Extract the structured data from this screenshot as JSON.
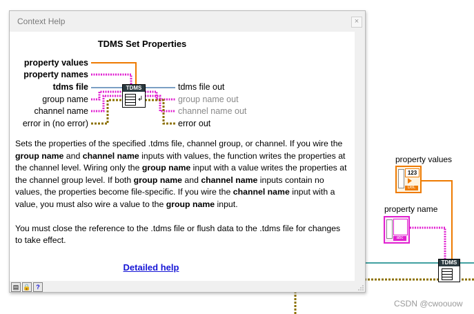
{
  "background": {
    "const_property_values_label": "property values",
    "const_property_name_label": "property name",
    "dbl_badge": "DBL",
    "abc_badge": "abc",
    "num_badge": "123",
    "node_label": "TDMS"
  },
  "window": {
    "title": "Context Help",
    "close": "×"
  },
  "help": {
    "heading": "TDMS Set Properties",
    "node_label": "TDMS",
    "inputs": {
      "property_values": "property values",
      "property_names": "property names",
      "tdms_file": "tdms file",
      "group_name": "group name",
      "channel_name": "channel name",
      "error_in": "error in (no error)"
    },
    "outputs": {
      "tdms_file_out": "tdms file out",
      "group_name_out": "group name out",
      "channel_name_out": "channel name out",
      "error_out": "error out"
    },
    "p1": {
      "s1": "Sets the properties of the specified .tdms file, channel group, or channel.  If you wire the ",
      "b1": "group name",
      "s2": " and ",
      "b2": "channel name",
      "s3": " inputs with values, the function writes the properties at the channel level. Wiring only the ",
      "b3": "group name",
      "s4": " input with a value writes the properties at the channel group level.  If both ",
      "b4": "group name",
      "s5": " and ",
      "b5": "channel name",
      "s6": " inputs contain no values, the properties become file-specific. If you wire the ",
      "b6": "channel name",
      "s7": " input with a value, you must also wire a value to the ",
      "b7": "group name",
      "s8": " input."
    },
    "p2": "You must close the reference to the .tdms file or flush data to the .tdms file for changes to take effect.",
    "detailed_help": "Detailed help"
  },
  "toolbar": {
    "show_optional_terminals": "show-optional-terminals-icon",
    "lock": "lock-icon",
    "help": "?"
  },
  "watermark": "CSDN @cwoouow",
  "colors": {
    "orange_wire": "#ee7a00",
    "pink_wire": "#e020d0",
    "blue_wire": "#2a66a0",
    "teal_wire": "#008080",
    "yellow_wire": "#c8a000",
    "link_blue": "#1515d6"
  }
}
